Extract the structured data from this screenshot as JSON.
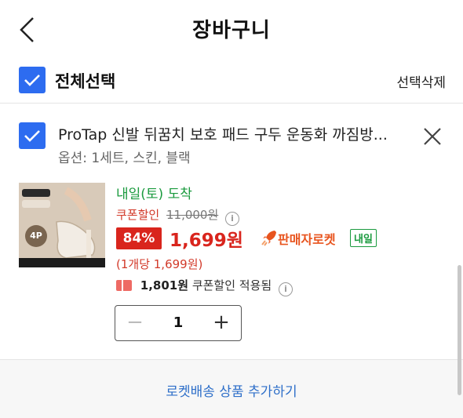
{
  "header": {
    "title": "장바구니"
  },
  "select_all": {
    "label": "전체선택",
    "delete_label": "선택삭제"
  },
  "item": {
    "name": "ProTap 신발 뒤꿈치 보호 패드 구두 운동화 까짐방...",
    "option": "옵션: 1세트, 스킨, 블랙",
    "thumb_badge": "4P",
    "delivery": "내일(토) 도착",
    "coupon_label": "쿠폰할인",
    "original_price": "11,000원",
    "discount_rate": "84%",
    "sale_price": "1,699원",
    "rocket_label": "판매자로켓",
    "tomorrow_badge": "내일",
    "unit_price": "(1개당 1,699원)",
    "applied_amount": "1,801원",
    "applied_label": "쿠폰할인 적용됨",
    "quantity": "1",
    "minus": "−",
    "plus": "+"
  },
  "footer": {
    "add_label": "로켓배송 상품 추가하기"
  },
  "colors": {
    "accent": "#2d6cf0",
    "sale": "#d9251d",
    "delivery": "#1a9a3e",
    "link": "#2e6fc9"
  }
}
